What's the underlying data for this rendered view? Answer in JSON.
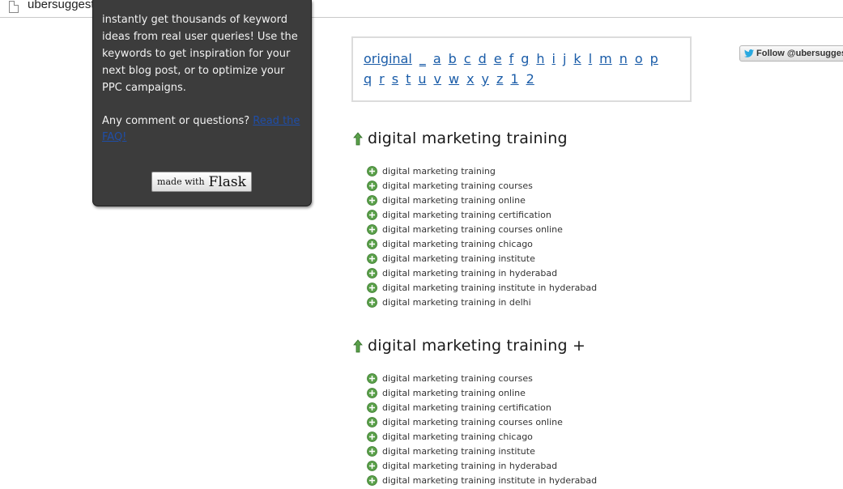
{
  "browser": {
    "url": "ubersuggest.org"
  },
  "sidebar": {
    "description": "instantly get thousands of keyword ideas from real user queries! Use the keywords to get inspiration for your next blog post, or to optimize your PPC campaigns.",
    "question_text": "Any comment or questions?",
    "faq_link": "Read the FAQ!",
    "badge_small": "made with",
    "badge_big": "Flask"
  },
  "letters": {
    "row1": [
      "original",
      "_",
      "a",
      "b",
      "c",
      "d",
      "e",
      "f",
      "g",
      "h",
      "i",
      "j",
      "k",
      "l",
      "m",
      "n",
      "o",
      "p"
    ],
    "row2": [
      "q",
      "r",
      "s",
      "t",
      "u",
      "v",
      "w",
      "x",
      "y",
      "z",
      "1",
      "2"
    ]
  },
  "twitter": {
    "label": "Follow @ubersuggest"
  },
  "sections": [
    {
      "title": "digital marketing training",
      "keywords": [
        "digital marketing training",
        "digital marketing training courses",
        "digital marketing training online",
        "digital marketing training certification",
        "digital marketing training courses online",
        "digital marketing training chicago",
        "digital marketing training institute",
        "digital marketing training in hyderabad",
        "digital marketing training institute in hyderabad",
        "digital marketing training in delhi"
      ]
    },
    {
      "title": "digital marketing training +",
      "keywords": [
        "digital marketing training courses",
        "digital marketing training online",
        "digital marketing training certification",
        "digital marketing training courses online",
        "digital marketing training chicago",
        "digital marketing training institute",
        "digital marketing training in hyderabad",
        "digital marketing training institute in hyderabad"
      ]
    }
  ],
  "colors": {
    "sidebar_bg": "#3c3c3c",
    "link": "#1a5ca8",
    "plus_green": "#5aa04a",
    "twitter_blue": "#2aa9e0"
  }
}
